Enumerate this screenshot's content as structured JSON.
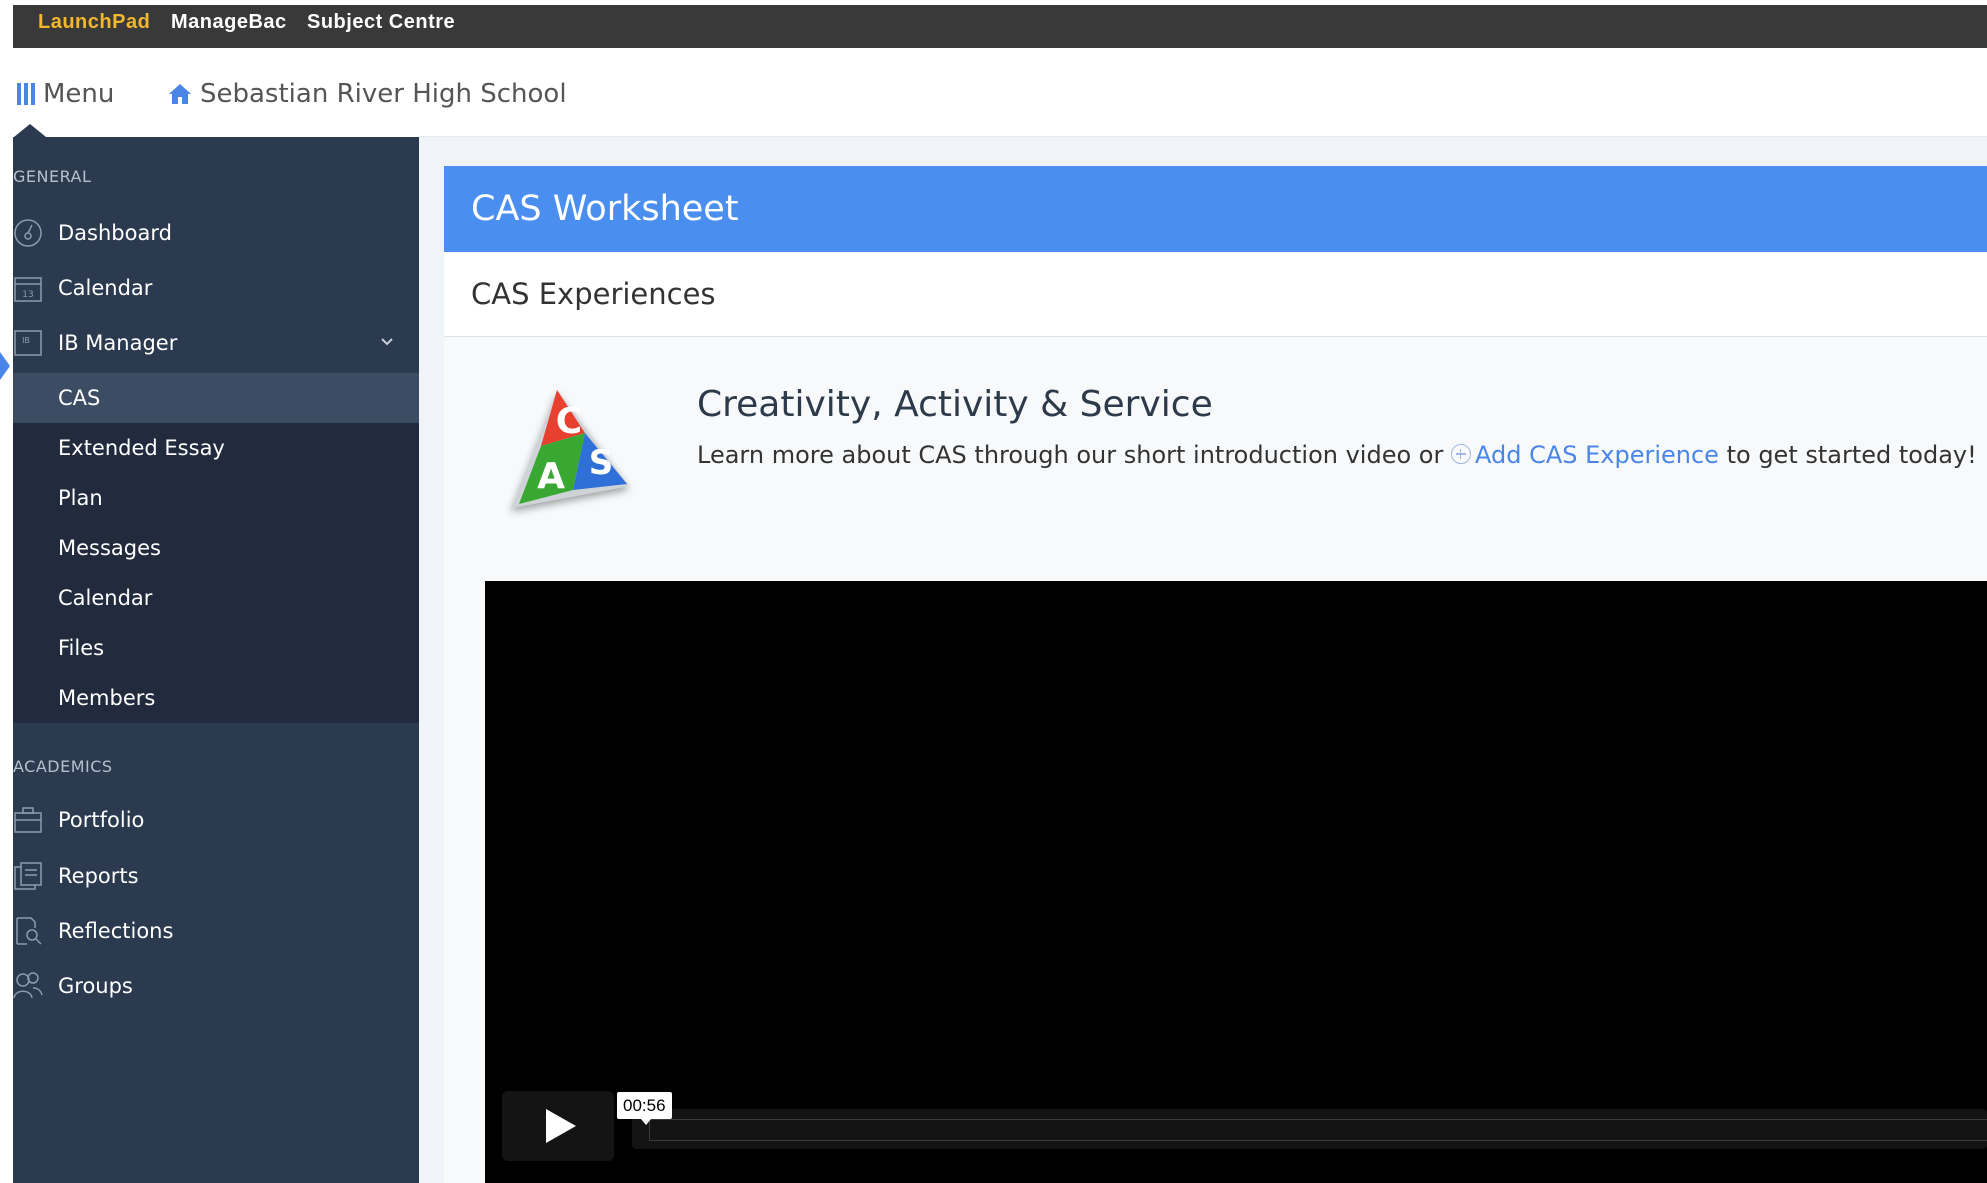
{
  "topbar": {
    "links": [
      {
        "label": "LaunchPad",
        "color": "#f2b72c"
      },
      {
        "label": "ManageBac",
        "color": "#ffffff"
      },
      {
        "label": "Subject Centre",
        "color": "#ffffff"
      }
    ]
  },
  "header": {
    "menu_label": "Menu",
    "school_name": "Sebastian River High School"
  },
  "sidebar": {
    "general_label": "GENERAL",
    "general_items": [
      {
        "label": "Dashboard",
        "icon": "dashboard-icon"
      },
      {
        "label": "Calendar",
        "icon": "calendar-icon"
      },
      {
        "label": "IB Manager",
        "icon": "ib-icon"
      }
    ],
    "ib_subitems": [
      {
        "label": "CAS",
        "active": true
      },
      {
        "label": "Extended Essay"
      },
      {
        "label": "Plan"
      },
      {
        "label": "Messages"
      },
      {
        "label": "Calendar"
      },
      {
        "label": "Files"
      },
      {
        "label": "Members"
      }
    ],
    "academics_label": "ACADEMICS",
    "academics_items": [
      {
        "label": "Portfolio",
        "icon": "portfolio-icon"
      },
      {
        "label": "Reports",
        "icon": "reports-icon"
      },
      {
        "label": "Reflections",
        "icon": "reflections-icon"
      },
      {
        "label": "Groups",
        "icon": "groups-icon"
      }
    ]
  },
  "main": {
    "title": "CAS Worksheet",
    "subtitle": "CAS Experiences",
    "intro_title": "Creativity, Activity & Service",
    "intro_prefix": "Learn more about CAS through our short introduction video or ",
    "intro_link": "Add CAS Experience",
    "intro_suffix": " to get started today!",
    "logo_letters": [
      "C",
      "A",
      "S"
    ]
  },
  "video": {
    "time_tooltip": "00:56"
  },
  "colors": {
    "accent": "#4a8ff0",
    "sidebar": "#2b3a4f",
    "topbar": "#393939",
    "launchpad": "#f2b72c"
  }
}
